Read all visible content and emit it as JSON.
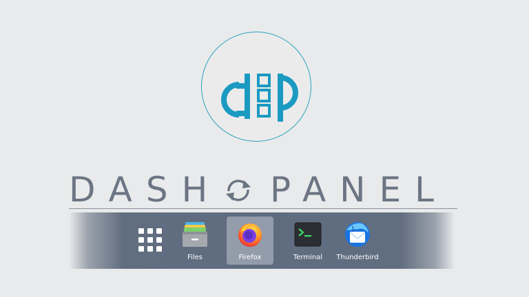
{
  "logo": {
    "letters": "dp",
    "accent": "#1b9ac1"
  },
  "wordmark": {
    "left": "DASH",
    "right": "PANEL",
    "color": "#6c7584",
    "icon": "swap-arrows-icon"
  },
  "dock": {
    "show_apps_icon": "app-grid-icon",
    "items": [
      {
        "label": "Files",
        "icon": "files-icon",
        "active": false
      },
      {
        "label": "Firefox",
        "icon": "firefox-icon",
        "active": true
      },
      {
        "label": "Terminal",
        "icon": "terminal-icon",
        "active": false
      },
      {
        "label": "Thunderbird",
        "icon": "thunderbird-icon",
        "active": false
      }
    ]
  },
  "colors": {
    "background": "#e9eaeb",
    "dock": "#5f6c80",
    "logo_blue": "#1b9ac1"
  }
}
